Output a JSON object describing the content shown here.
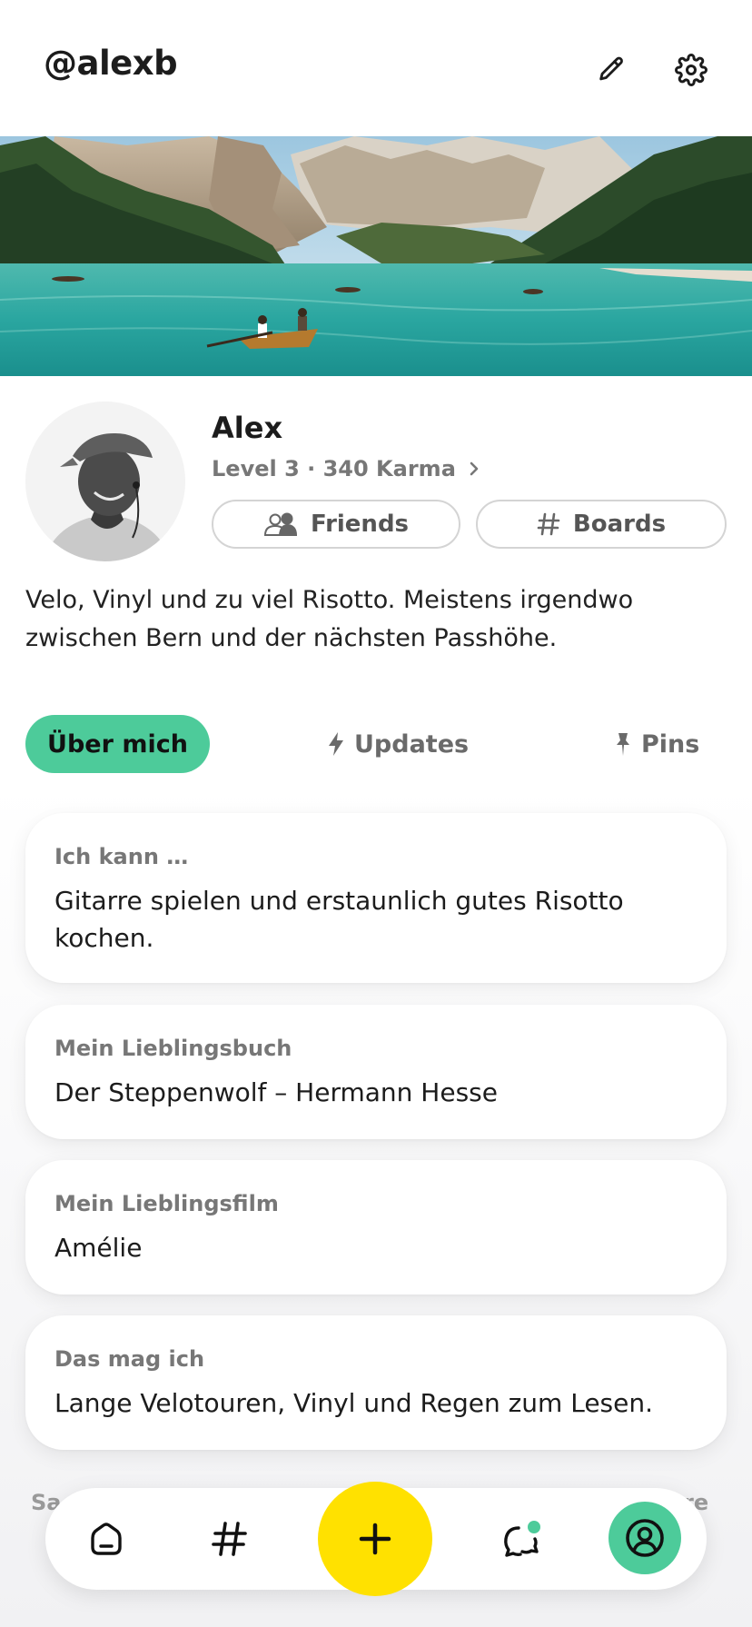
{
  "header": {
    "handle": "@alexb",
    "edit_icon": "pencil-icon",
    "settings_icon": "gear-icon"
  },
  "profile": {
    "name": "Alex",
    "level": "Level 3 · 340 Karma",
    "friends_label": "Friends",
    "boards_label": "Boards",
    "bio": "Velo, Vinyl und zu viel Risotto. Meistens irgendwo zwischen Bern und der nächsten Passhöhe."
  },
  "tabs": [
    {
      "label": "Über mich",
      "active": true
    },
    {
      "label": "Updates",
      "icon": "lightning-icon"
    },
    {
      "label": "Pins",
      "icon": "pin-icon"
    }
  ],
  "cards": [
    {
      "label": "Ich kann …",
      "value": "Gitarre spielen und erstaunlich gutes Risotto kochen."
    },
    {
      "label": "Mein Lieblingsbuch",
      "value": "Der Steppenwolf – Hermann Hesse"
    },
    {
      "label": "Mein Lieblingsfilm",
      "value": "Amélie"
    },
    {
      "label": "Das mag ich",
      "value": "Lange Velotouren, Vinyl und Regen zum Lesen."
    }
  ],
  "peek": {
    "left": "Sa",
    "right": "re"
  },
  "nav": {
    "items": [
      "home-icon",
      "hashtag-icon",
      "plus-icon",
      "messages-icon",
      "profile-icon"
    ],
    "active": "profile-icon"
  },
  "colors": {
    "accent_green": "#4dcb9a",
    "accent_yellow": "#ffe100",
    "text": "#1c1c1c",
    "muted": "#777777"
  }
}
